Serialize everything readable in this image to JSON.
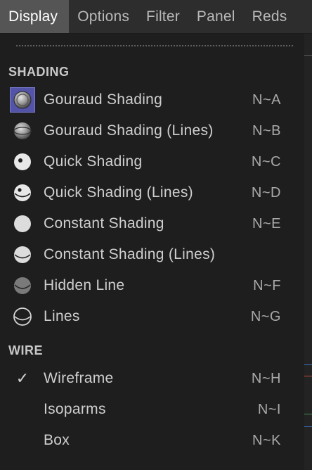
{
  "menubar": {
    "items": [
      {
        "label": "Display"
      },
      {
        "label": "Options"
      },
      {
        "label": "Filter"
      },
      {
        "label": "Panel"
      },
      {
        "label": "Reds"
      }
    ]
  },
  "dropdown": {
    "sections": {
      "shading": "SHADING",
      "wire": "WIRE"
    },
    "shading_items": [
      {
        "label": "Gouraud Shading",
        "shortcut": "N~A",
        "icon": "gouraud-shading-icon",
        "selected": true
      },
      {
        "label": "Gouraud Shading (Lines)",
        "shortcut": "N~B",
        "icon": "gouraud-shading-lines-icon"
      },
      {
        "label": "Quick Shading",
        "shortcut": "N~C",
        "icon": "quick-shading-icon"
      },
      {
        "label": "Quick Shading (Lines)",
        "shortcut": "N~D",
        "icon": "quick-shading-lines-icon"
      },
      {
        "label": "Constant Shading",
        "shortcut": "N~E",
        "icon": "constant-shading-icon"
      },
      {
        "label": "Constant Shading (Lines)",
        "shortcut": "",
        "icon": "constant-shading-lines-icon"
      },
      {
        "label": "Hidden Line",
        "shortcut": "N~F",
        "icon": "hidden-line-icon"
      },
      {
        "label": "Lines",
        "shortcut": "N~G",
        "icon": "lines-icon"
      }
    ],
    "wire_items": [
      {
        "label": "Wireframe",
        "shortcut": "N~H",
        "checked": true,
        "icon": "checkmark-icon",
        "check_glyph": "✓"
      },
      {
        "label": "Isoparms",
        "shortcut": "N~I"
      },
      {
        "label": "Box",
        "shortcut": "N~K"
      }
    ]
  },
  "colors": {
    "menubar_bg": "#2d2d2d",
    "menubar_active": "#555555",
    "menu_bg": "#1e1e1e",
    "selected_icon_bg": "#5353a8",
    "text": "#cfcfcf",
    "shortcut_text": "#a9a9a9"
  }
}
